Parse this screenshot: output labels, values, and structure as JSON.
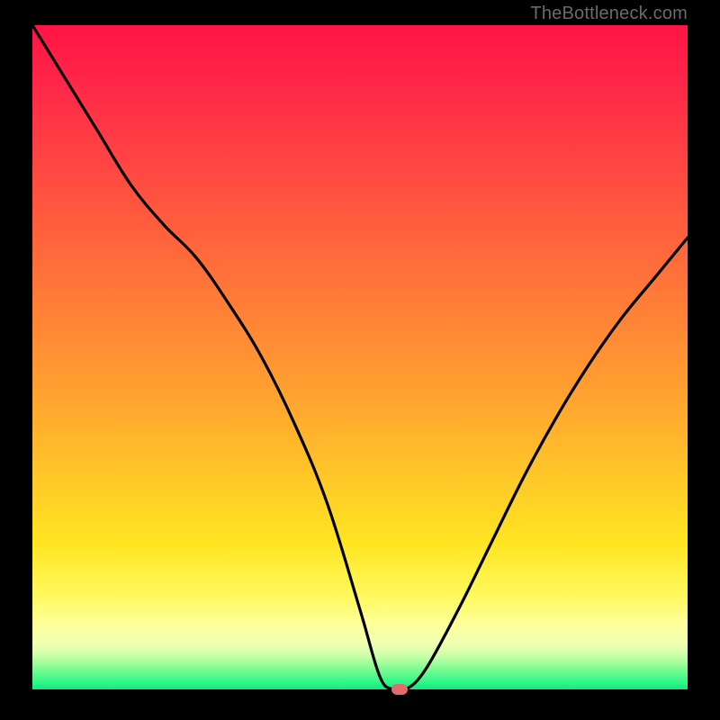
{
  "attribution": "TheBottleneck.com",
  "colors": {
    "curve_stroke": "#000000",
    "marker_fill": "#e06a6d",
    "frame_bg": "#000000"
  },
  "chart_data": {
    "type": "line",
    "title": "",
    "xlabel": "",
    "ylabel": "",
    "xlim": [
      0,
      100
    ],
    "ylim": [
      0,
      100
    ],
    "x": [
      0,
      5,
      10,
      15,
      20,
      25,
      30,
      35,
      40,
      45,
      50,
      53,
      55,
      57,
      60,
      65,
      70,
      75,
      80,
      85,
      90,
      95,
      100
    ],
    "values": [
      100,
      92,
      84,
      76,
      70,
      65,
      58,
      50,
      40,
      28,
      12,
      2,
      0,
      0,
      3,
      12,
      22,
      32,
      41,
      49,
      56,
      62,
      68
    ],
    "marker": {
      "x": 56,
      "y": 0
    },
    "gradient_bands_pct": {
      "red_to_orange": [
        0,
        55
      ],
      "orange_to_yellow": [
        55,
        88
      ],
      "yellow_white": [
        88,
        93
      ],
      "green": [
        93,
        100
      ]
    }
  }
}
